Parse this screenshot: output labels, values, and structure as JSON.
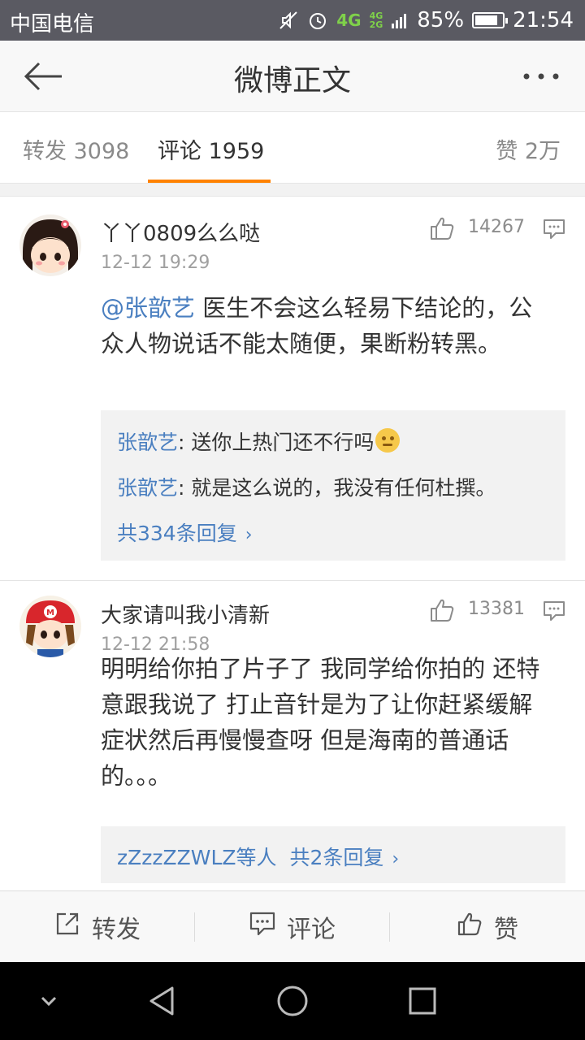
{
  "status_bar": {
    "carrier": "中国电信",
    "network_4g": "4G",
    "network_stack_top": "4G",
    "network_stack_bottom": "2G",
    "battery": "85%",
    "battery_level": 0.85,
    "time": "21:54"
  },
  "header": {
    "title": "微博正文",
    "back_icon": "back-arrow-icon",
    "more_icon": "more-dots-icon"
  },
  "tabs": {
    "repost": "转发 3098",
    "comments": "评论 1959",
    "likes": "赞 2万",
    "active": "comments",
    "accent": "#ff8200"
  },
  "comments": [
    {
      "username": "丫丫0809么么哒",
      "time": "12-12 19:29",
      "likes": "14267",
      "mention": "@张歆艺",
      "text": " 医生不会这么轻易下结论的，公众人物说话不能太随便，果断粉转黑。",
      "replies": [
        {
          "who": "张歆艺",
          "text": ": 送你上热门还不行吗"
        },
        {
          "who": "张歆艺",
          "text": ": 就是这么说的，我没有任何杜撰。"
        }
      ],
      "more_replies": "共334条回复"
    },
    {
      "username": "大家请叫我小清新",
      "time": "12-12 21:58",
      "likes": "13381",
      "text": "明明给你拍了片子了 我同学给你拍的 还特意跟我说了 打止音针是为了让你赶紧缓解症状然后再慢慢查呀 但是海南的普通话的。。。",
      "replies_summary_users": "zZzzZZWLZ等人",
      "more_replies": "共2条回复"
    }
  ],
  "action_bar": {
    "repost": "转发",
    "comment": "评论",
    "like": "赞"
  },
  "colors": {
    "link": "#4a7fc0",
    "status_bar_bg": "#5a5a62"
  }
}
